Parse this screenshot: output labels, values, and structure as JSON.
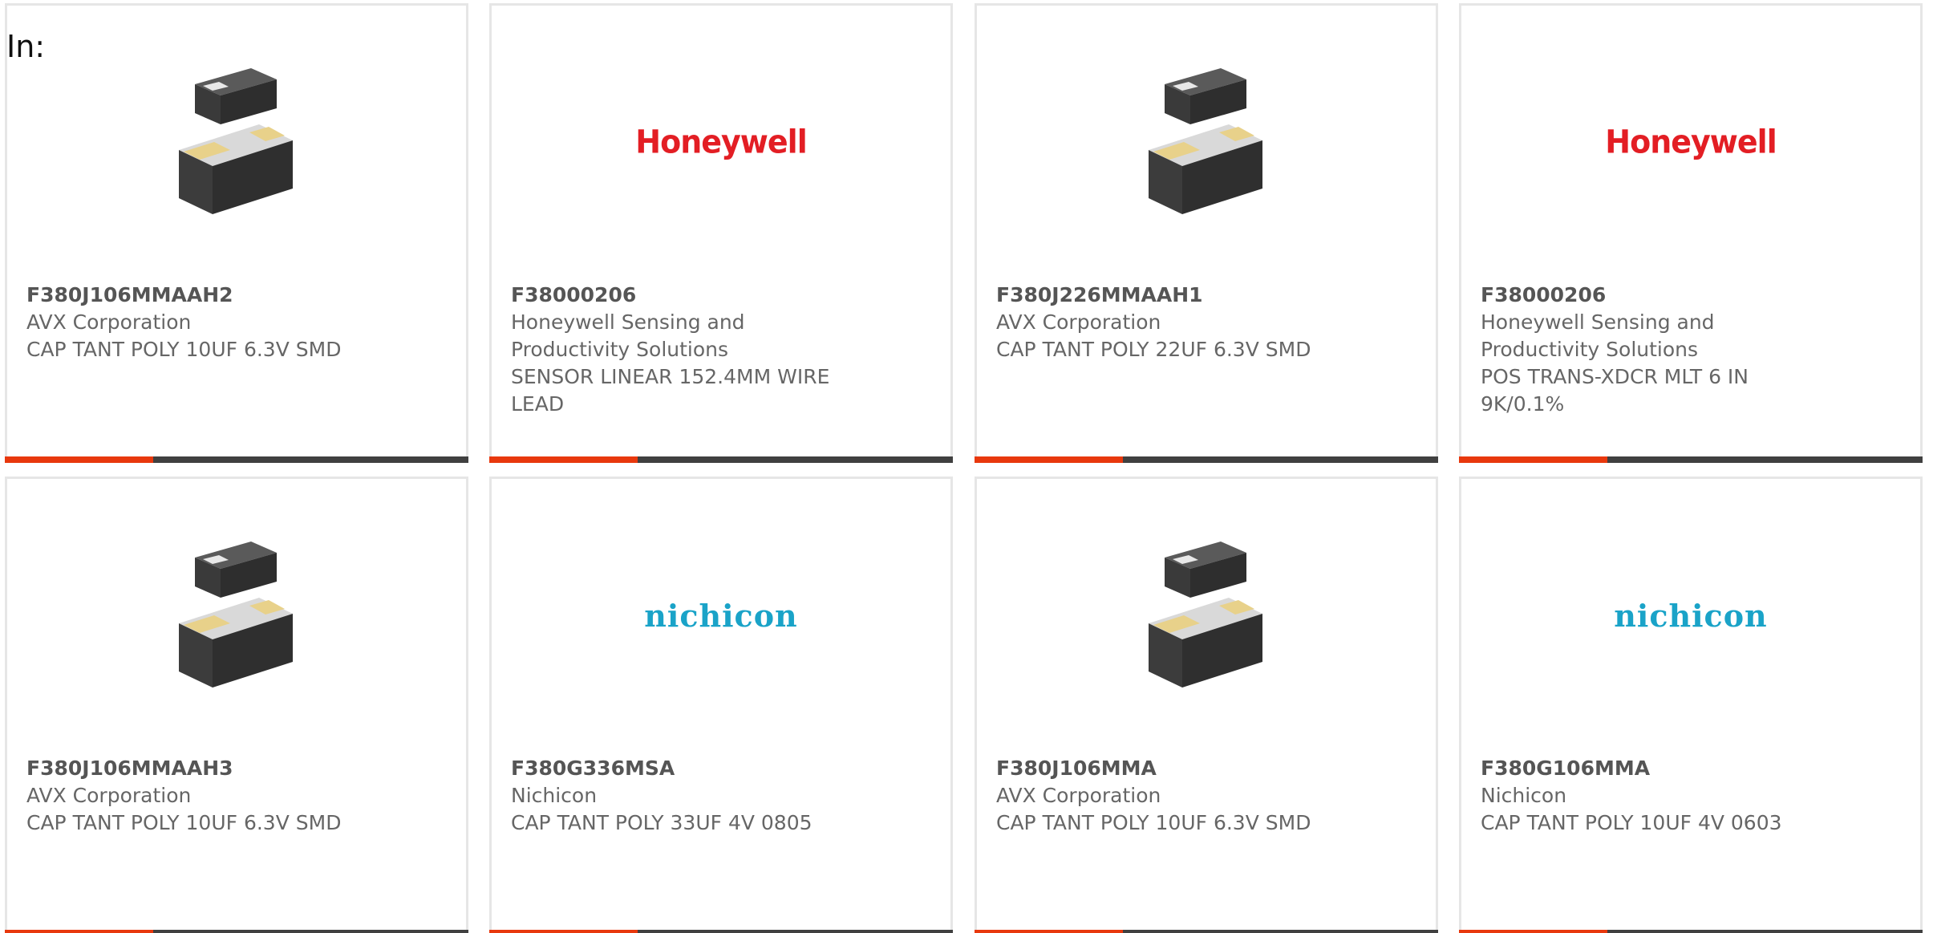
{
  "header": {
    "label": "In:"
  },
  "colors": {
    "accent": "#e8380d",
    "bar": "#404040",
    "honeywell_red": "#e31e24",
    "nichicon_blue": "#1aa3c8",
    "text_gray": "#666666"
  },
  "cards": [
    {
      "image": "capacitor-chip-icon",
      "part_number": "F380J106MMAAH2",
      "manufacturer": "AVX Corporation",
      "description": "CAP TANT POLY 10UF 6.3V SMD"
    },
    {
      "image": "honeywell-logo",
      "logo_text": "Honeywell",
      "part_number": "F38000206",
      "manufacturer": "Honeywell Sensing and Productivity Solutions",
      "description": "SENSOR LINEAR 152.4MM WIRE LEAD"
    },
    {
      "image": "capacitor-chip-icon",
      "part_number": "F380J226MMAAH1",
      "manufacturer": "AVX Corporation",
      "description": "CAP TANT POLY 22UF 6.3V SMD"
    },
    {
      "image": "honeywell-logo",
      "logo_text": "Honeywell",
      "part_number": "F38000206",
      "manufacturer": "Honeywell Sensing and Productivity Solutions",
      "description": "POS TRANS-XDCR MLT 6 IN 9K/0.1%"
    },
    {
      "image": "capacitor-chip-icon",
      "part_number": "F380J106MMAAH3",
      "manufacturer": "AVX Corporation",
      "description": "CAP TANT POLY 10UF 6.3V SMD"
    },
    {
      "image": "nichicon-logo",
      "logo_text": "nichicon",
      "part_number": "F380G336MSA",
      "manufacturer": "Nichicon",
      "description": "CAP TANT POLY 33UF 4V 0805"
    },
    {
      "image": "capacitor-chip-icon",
      "part_number": "F380J106MMA",
      "manufacturer": "AVX Corporation",
      "description": "CAP TANT POLY 10UF 6.3V SMD"
    },
    {
      "image": "nichicon-logo",
      "logo_text": "nichicon",
      "part_number": "F380G106MMA",
      "manufacturer": "Nichicon",
      "description": "CAP TANT POLY 10UF 4V 0603"
    }
  ]
}
